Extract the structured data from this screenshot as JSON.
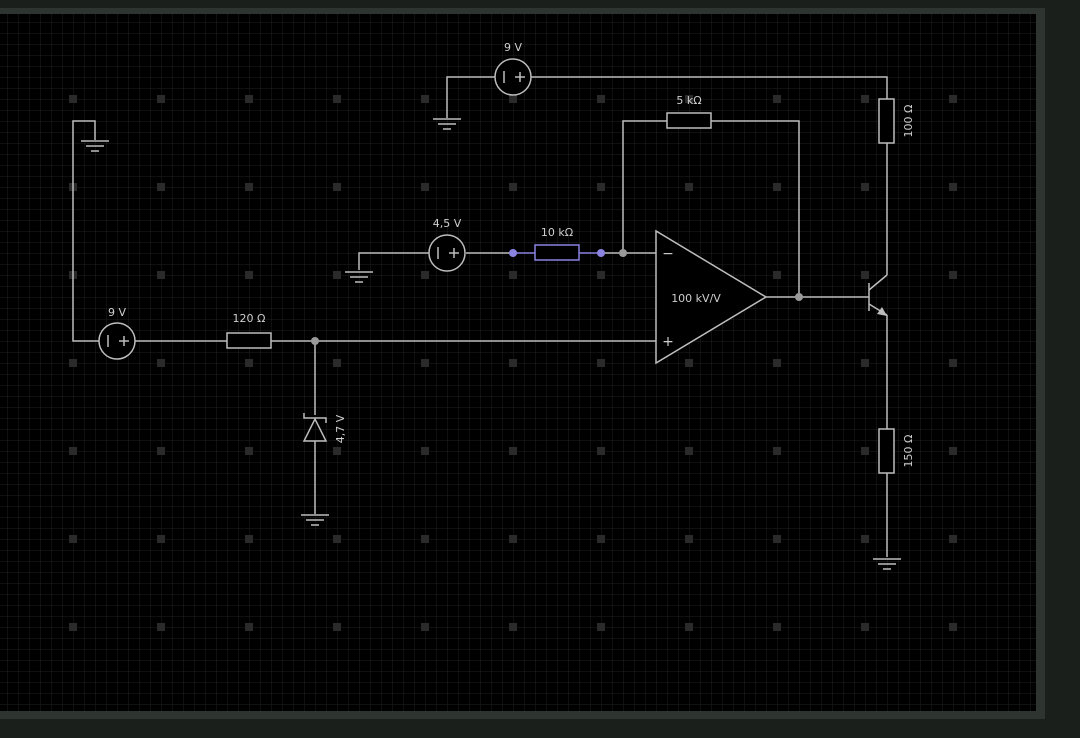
{
  "colors": {
    "background": "#000000",
    "frame": "#1b1f1c",
    "grid_minor": "#1e1e1e",
    "grid_major_dot": "#2a2a2a",
    "wire": "#bdbdbd",
    "selected": "#8a83e0",
    "junction": "#9a9a9a",
    "label": "#cfcfcf"
  },
  "components": {
    "vsource_top": {
      "label": "9 V",
      "icon": "voltage-source-icon"
    },
    "vsource_left": {
      "label": "9 V",
      "icon": "voltage-source-icon"
    },
    "vsource_mid": {
      "label": "4,5 V",
      "icon": "voltage-source-icon"
    },
    "resistor_feedback": {
      "label": "5 kΩ",
      "icon": "resistor-icon"
    },
    "resistor_input": {
      "label": "10 kΩ",
      "icon": "resistor-icon",
      "selected": true
    },
    "resistor_series": {
      "label": "120 Ω",
      "icon": "resistor-icon"
    },
    "resistor_collector": {
      "label": "100 Ω",
      "icon": "resistor-icon"
    },
    "resistor_emitter": {
      "label": "150 Ω",
      "icon": "resistor-icon"
    },
    "zener": {
      "label": "4,7 V",
      "icon": "zener-diode-icon"
    },
    "opamp": {
      "label": "100 kV/V",
      "minus": "−",
      "plus": "+",
      "icon": "op-amp-icon"
    },
    "transistor": {
      "icon": "npn-transistor-icon"
    }
  }
}
